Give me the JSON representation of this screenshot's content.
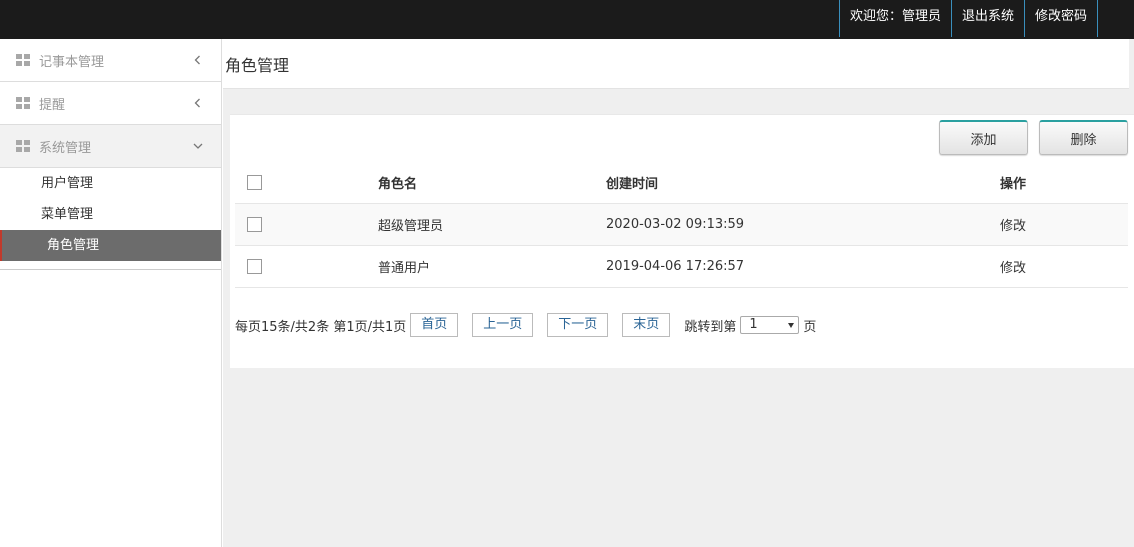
{
  "topbar": {
    "welcome": "欢迎您：管理员",
    "logout": "退出系统",
    "change_password": "修改密码"
  },
  "sidebar": {
    "groups": [
      {
        "label": "记事本管理",
        "icon": "grid-icon",
        "expanded": false
      },
      {
        "label": "提醒",
        "icon": "grid-icon",
        "expanded": false
      },
      {
        "label": "系统管理",
        "icon": "grid-icon",
        "expanded": true
      }
    ],
    "sub_items": [
      {
        "label": "用户管理"
      },
      {
        "label": "菜单管理"
      },
      {
        "label": "角色管理",
        "active": true
      }
    ]
  },
  "page": {
    "title": "角色管理"
  },
  "toolbar": {
    "add_label": "添加",
    "delete_label": "删除"
  },
  "table": {
    "headers": [
      "",
      "角色名",
      "创建时间",
      "操作"
    ],
    "rows": [
      {
        "name": "超级管理员",
        "created": "2020-03-02 09:13:59",
        "action": "修改"
      },
      {
        "name": "普通用户",
        "created": "2019-04-06 17:26:57",
        "action": "修改"
      }
    ]
  },
  "pager": {
    "summary": "每页15条/共2条 第1页/共1页",
    "first": "首页",
    "prev": "上一页",
    "next": "下一页",
    "last": "末页",
    "jump_prefix": "跳转到第",
    "jump_value": "1",
    "jump_suffix": "页"
  },
  "colors": {
    "topbar": "#1b1b1b",
    "active_item": "#6c6c6c",
    "accent": "#2aa0a0",
    "content_bg": "#efefef"
  }
}
